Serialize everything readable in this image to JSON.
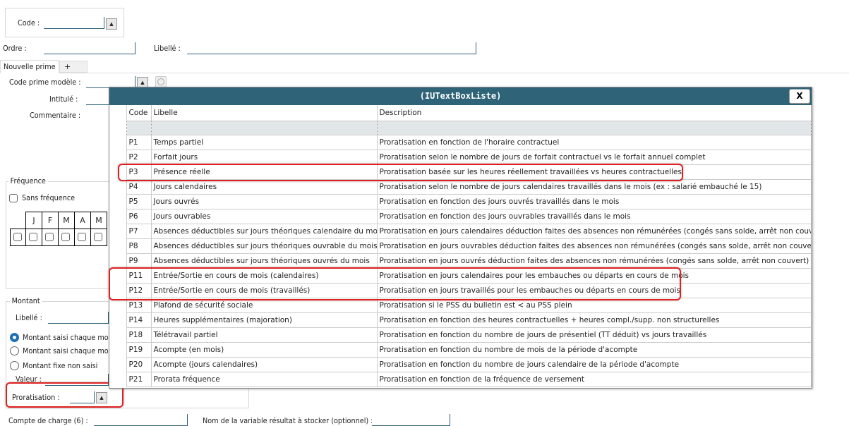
{
  "form": {
    "code_label": "Code :",
    "ordre_label": "Ordre :",
    "libelle_label": "Libellé :",
    "tabs": [
      {
        "label": "Nouvelle prime"
      },
      {
        "label": "+"
      }
    ],
    "code_prime_label": "Code prime modèle :",
    "intitule_label": "Intitulé :",
    "commentaire_label": "Commentaire :",
    "frequence": {
      "title": "Fréquence",
      "sans_label": "Sans fréquence",
      "months": [
        "J",
        "F",
        "M",
        "A",
        "M"
      ]
    },
    "montant": {
      "title": "Montant",
      "libelle_label": "Libellé :",
      "radios": [
        {
          "label": "Montant saisi chaque mois",
          "checked": true
        },
        {
          "label": "Montant saisi chaque mois",
          "checked": false
        },
        {
          "label": "Montant fixe non saisi",
          "checked": false
        }
      ],
      "valeur_label": "Valeur :",
      "proratisation_label": "Proratisation :"
    },
    "compte_label": "Compte de charge (6) :",
    "variable_label": "Nom de la variable résultat à stocker (optionnel) :"
  },
  "popup": {
    "title": "(IUTextBoxListe)",
    "close_label": "X",
    "columns": [
      "Code",
      "Libelle",
      "Description"
    ],
    "rows": [
      [
        "P1",
        "Temps partiel",
        "Proratisation en fonction de l'horaire contractuel"
      ],
      [
        "P2",
        "Forfait jours",
        "Proratisation selon le nombre de jours de forfait contractuel vs le forfait annuel complet"
      ],
      [
        "P3",
        "Présence réelle",
        "Proratisation basée sur les heures réellement travaillées vs heures contractuelles"
      ],
      [
        "P4",
        "Jours calendaires",
        "Proratisation selon le nombre de jours calendaires travaillés dans le mois (ex : salarié embauché le 15)"
      ],
      [
        "P5",
        "Jours ouvrés",
        "Proratisation en fonction des jours ouvrés travaillés dans le mois"
      ],
      [
        "P6",
        "Jours ouvrables",
        "Proratisation en fonction des jours ouvrables travaillés dans le mois"
      ],
      [
        "P7",
        "Absences déductibles sur jours théoriques calendaire du mois",
        "Proratisation en jours calendaires déduction faites des absences non rémunérées (congés sans solde, arrêt non couvert)"
      ],
      [
        "P8",
        "Absences déductibles sur jours théoriques ouvrable du mois",
        "Proratisation en jours ouvrables déduction faites des absences non rémunérées (congés sans solde, arrêt non couvert)"
      ],
      [
        "P9",
        "Absences déductibles sur jours théoriques ouvrés du mois",
        "Proratisation en jours ouvrés déduction faites des absences non rémunérées (congés sans solde, arrêt non couvert)"
      ],
      [
        "P11",
        "Entrée/Sortie en cours de mois (calendaires)",
        "Proratisation en jours calendaires pour les embauches ou départs en cours de mois"
      ],
      [
        "P12",
        "Entrée/Sortie en cours de mois (travaillés)",
        "Proratisation en jours travaillés pour les embauches ou départs en cours de mois"
      ],
      [
        "P13",
        "Plafond de sécurité sociale",
        "Proratisation si le PSS du bulletin est < au PSS plein"
      ],
      [
        "P14",
        "Heures supplémentaires (majoration)",
        "Proratisation en fonction des heures contractuelles + heures compl./supp. non structurelles"
      ],
      [
        "P18",
        "Télétravail partiel",
        "Proratisation en fonction du nombre de jours de présentiel (TT déduit) vs jours travaillés"
      ],
      [
        "P19",
        "Acompte (en mois)",
        "Proratisation en fonction du nombre de mois de la période d'acompte"
      ],
      [
        "P20",
        "Acompte (jours calendaires)",
        "Proratisation en fonction du nombre de jours calendaire de la période d'acompte"
      ],
      [
        "P21",
        "Prorata fréquence",
        "Proratisation en fonction de la fréquence de versement"
      ]
    ]
  },
  "colors": {
    "accent": "#2e6378",
    "highlight": "#e02020"
  }
}
